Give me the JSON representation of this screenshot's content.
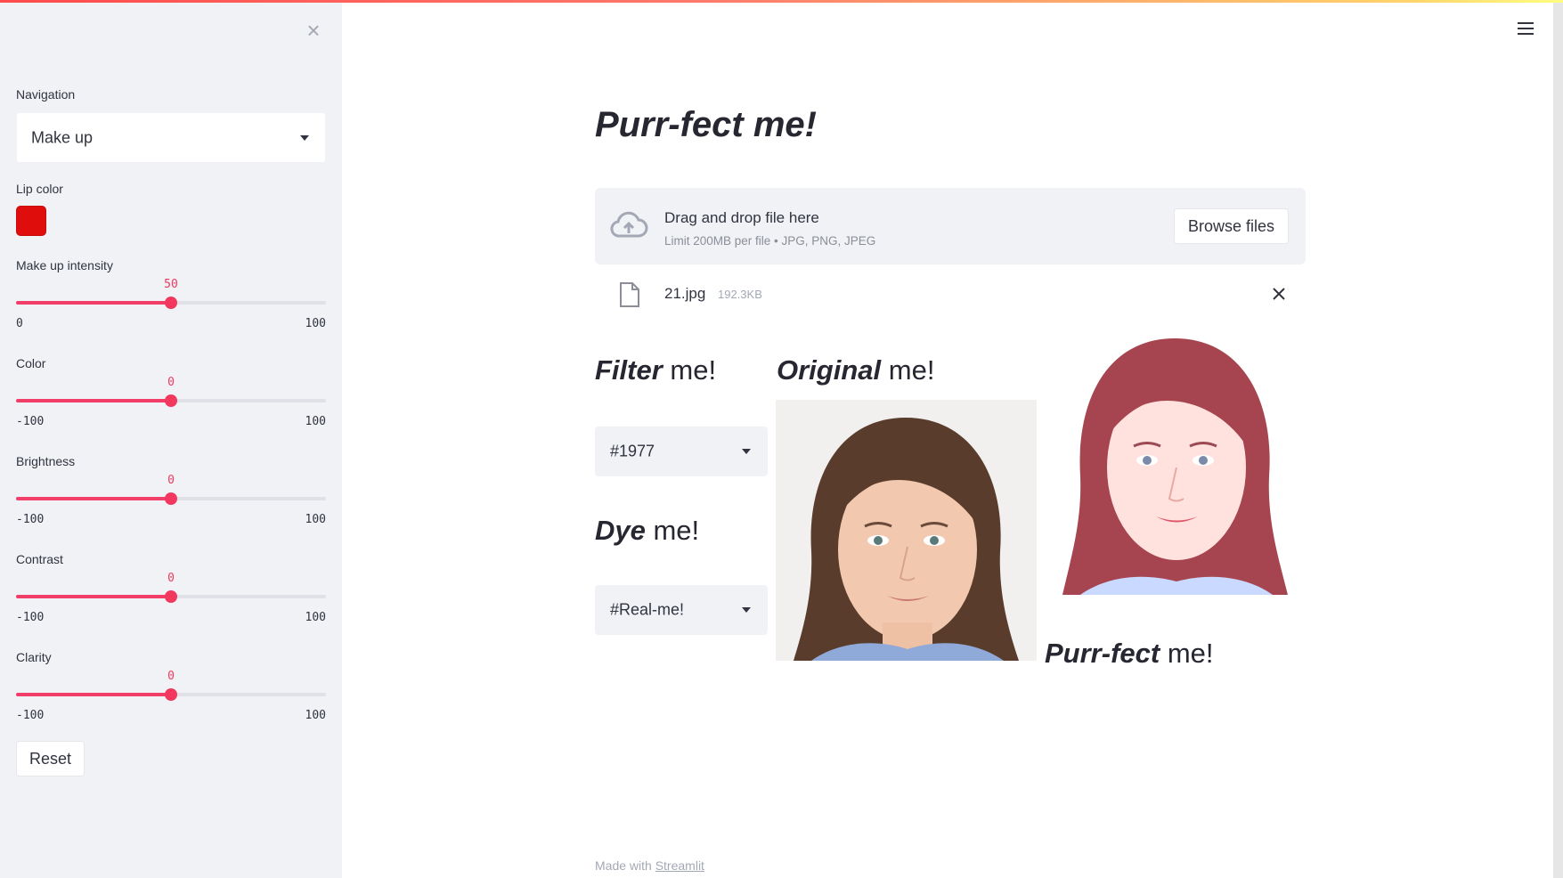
{
  "sidebar": {
    "navigation_label": "Navigation",
    "navigation_value": "Make up",
    "lip_color_label": "Lip color",
    "lip_color": "#e00d0d",
    "sliders": [
      {
        "label": "Make up intensity",
        "value": 50,
        "min": 0,
        "max": 100
      },
      {
        "label": "Color",
        "value": 0,
        "min": -100,
        "max": 100
      },
      {
        "label": "Brightness",
        "value": 0,
        "min": -100,
        "max": 100
      },
      {
        "label": "Contrast",
        "value": 0,
        "min": -100,
        "max": 100
      },
      {
        "label": "Clarity",
        "value": 0,
        "min": -100,
        "max": 100
      }
    ],
    "reset_label": "Reset"
  },
  "main": {
    "title": "Purr-fect me!",
    "uploader": {
      "drag_text": "Drag and drop file here",
      "limit_text": "Limit 200MB per file • JPG, PNG, JPEG",
      "browse_label": "Browse files"
    },
    "file": {
      "name": "21.jpg",
      "size": "192.3KB"
    },
    "filter": {
      "heading_bold": "Filter",
      "heading_rest": " me!",
      "value": "#1977"
    },
    "dye": {
      "heading_bold": "Dye",
      "heading_rest": " me!",
      "value": "#Real-me!"
    },
    "original": {
      "heading_bold": "Original",
      "heading_rest": " me!"
    },
    "result": {
      "heading_bold": "Purr-fect",
      "heading_rest": " me!"
    }
  },
  "footer": {
    "prefix": "Made with ",
    "link": "Streamlit"
  },
  "colors": {
    "accent": "#f2385f",
    "sidebar_bg": "#f0f2f6"
  }
}
